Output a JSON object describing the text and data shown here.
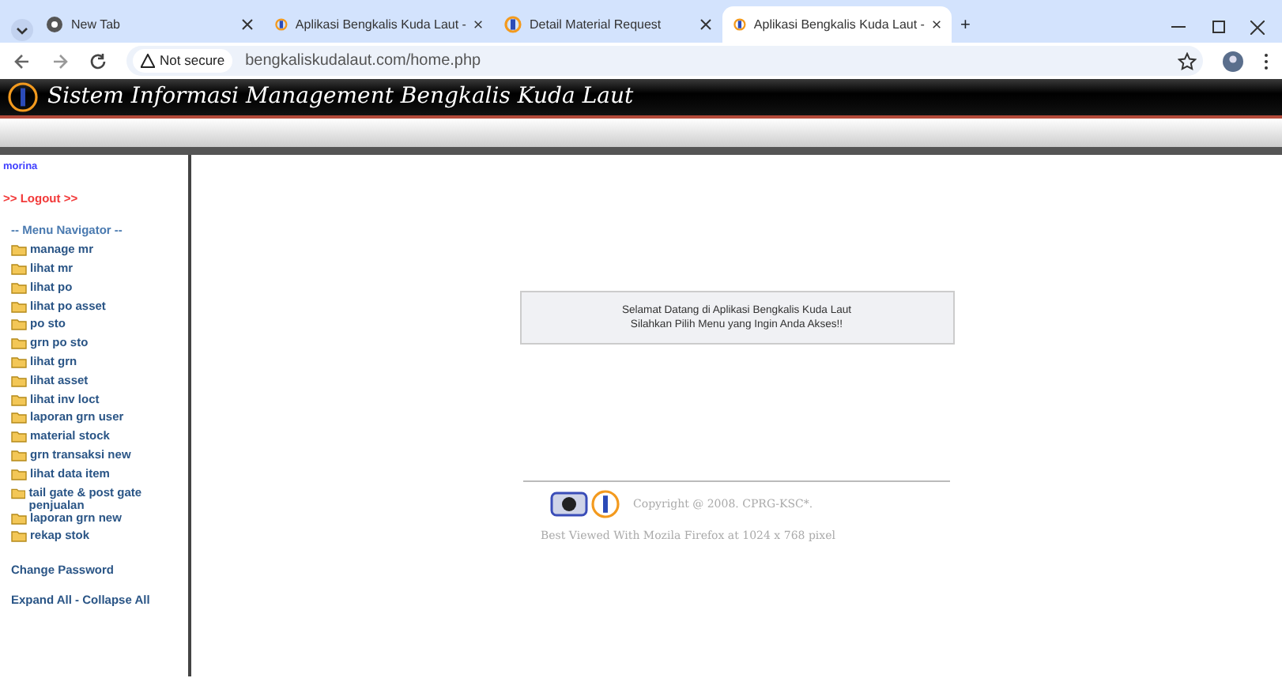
{
  "browser": {
    "tabs": [
      {
        "title": "New Tab",
        "kind": "browser",
        "selected": false
      },
      {
        "title": "Aplikasi Bengkalis Kuda Laut -",
        "kind": "site",
        "selected": false
      },
      {
        "title": "Detail Material Request",
        "kind": "site",
        "selected": false
      },
      {
        "title": "Aplikasi Bengkalis Kuda Laut -",
        "kind": "site",
        "selected": true
      }
    ],
    "new_tab": "+",
    "security": "Not secure",
    "url": "bengkaliskudalaut.com/home.php"
  },
  "header": {
    "title": "Sistem Informasi Management Bengkalis Kuda Laut"
  },
  "sidebar": {
    "user": "morina",
    "logout": ">> Logout >>",
    "menu_title": "-- Menu Navigator --",
    "items": [
      {
        "label": "manage mr"
      },
      {
        "label": "lihat mr"
      },
      {
        "label": "lihat po"
      },
      {
        "label": "lihat po asset"
      },
      {
        "label": "po sto"
      },
      {
        "label": "grn po sto"
      },
      {
        "label": "lihat grn"
      },
      {
        "label": "lihat asset"
      },
      {
        "label": "lihat inv loct"
      },
      {
        "label": "laporan grn user"
      },
      {
        "label": "material stock"
      },
      {
        "label": "grn transaksi new"
      },
      {
        "label": "lihat data item"
      },
      {
        "label": "tail gate & post gate penjualan"
      },
      {
        "label": "laporan grn new"
      },
      {
        "label": "rekap stok"
      }
    ],
    "links": [
      "Change Password",
      "Expand All - Collapse All"
    ]
  },
  "welcome": {
    "lines": [
      "Selamat Datang di Aplikasi Bengkalis Kuda Laut",
      "Silahkan Pilih Menu yang Ingin Anda Akses!!"
    ]
  },
  "footer": {
    "copyright": "Copyright @ 2008. CPRG-KSC*.",
    "best_viewed": "Best Viewed With Mozila Firefox at 1024 x 768 pixel"
  }
}
